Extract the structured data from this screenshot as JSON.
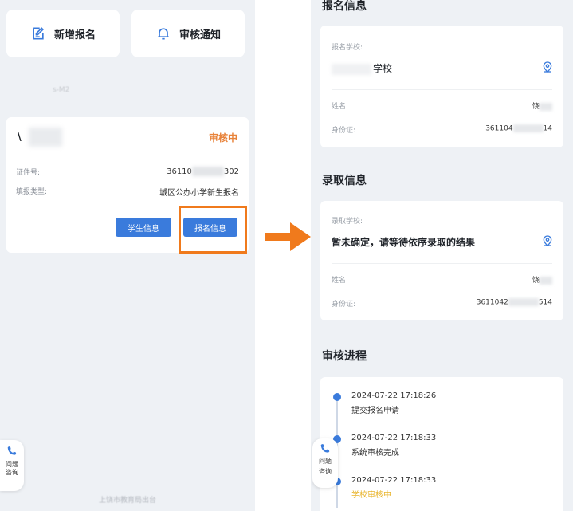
{
  "left": {
    "actions": [
      {
        "label": "新增报名",
        "icon": "edit-document-icon"
      },
      {
        "label": "审核通知",
        "icon": "bell-icon"
      }
    ],
    "blurred_heading": "s-M2",
    "registration": {
      "name": "\\",
      "status": "审核中",
      "id_label": "证件号:",
      "id_value": "36110",
      "id_value_tail": "302",
      "type_label": "填报类型:",
      "type_value": "城区公办小学新生报名",
      "btn_student": "学生信息",
      "btn_signup": "报名信息"
    },
    "consult": "问题\n咨询",
    "footer": "上饶市教育局出台"
  },
  "right": {
    "signup_section": {
      "title": "报名信息",
      "school_label": "报名学校:",
      "school_value": "学校",
      "name_label": "姓名:",
      "name_value": "饶",
      "id_label": "身份证:",
      "id_value": "361104",
      "id_value_tail": "14"
    },
    "admit_section": {
      "title": "录取信息",
      "school_label": "录取学校:",
      "school_value": "暂未确定，请等待依序录取的结果",
      "name_label": "姓名:",
      "name_value": "饶",
      "id_label": "身份证:",
      "id_value": "3611042",
      "id_value_tail": "514"
    },
    "progress": {
      "title": "审核进程",
      "steps": [
        {
          "time": "2024-07-22 17:18:26",
          "desc": "提交报名申请"
        },
        {
          "time": "2024-07-22 17:18:33",
          "desc": "系统审核完成"
        },
        {
          "time": "2024-07-22 17:18:33",
          "desc": "学校审核中"
        }
      ]
    },
    "consult_line1": "问题",
    "consult_line2": "咨询"
  },
  "colors": {
    "accent_blue": "#3a7bdc",
    "status_orange": "#e8833a",
    "highlight_orange": "#f07a1c",
    "pending_yellow": "#e8b42c"
  }
}
